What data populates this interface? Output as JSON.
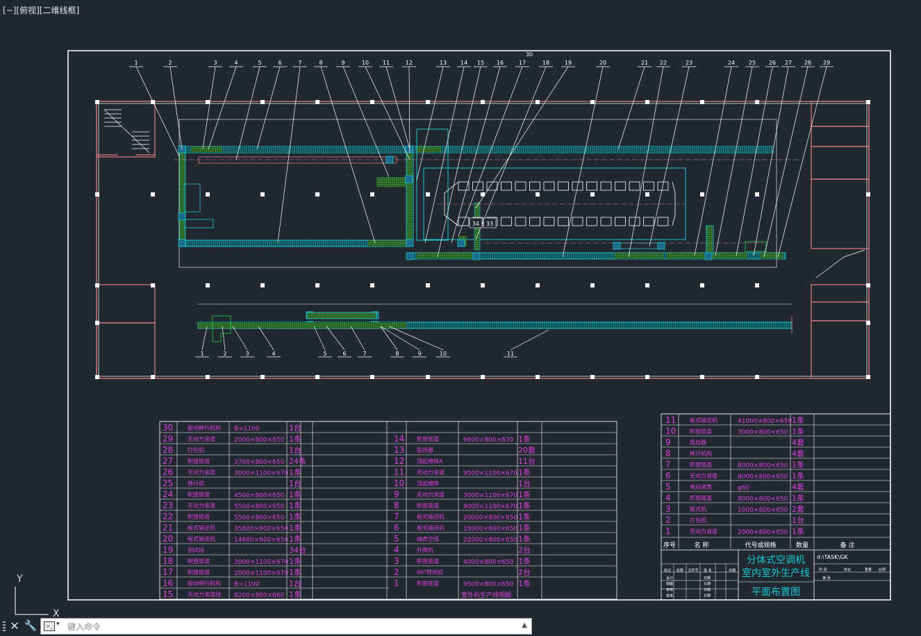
{
  "viewport": {
    "label": "[−][俯视][二维线框]"
  },
  "command": {
    "placeholder": "键入命令",
    "close_icon": "close-icon",
    "tool_icon": "wrench-icon",
    "prompt_icon": "command-prompt-icon",
    "up_icon": "caret-up-icon"
  },
  "ucs": {
    "x_label": "X",
    "y_label": "Y"
  },
  "colors": {
    "background": "#212830",
    "frame": "#ffffff",
    "wall": "#e87f7f",
    "conveyor": "#19c8d2",
    "roller": "#22b14c",
    "parts_text": "#e040e0"
  },
  "balloons_top": [
    "1",
    "2",
    "3",
    "4",
    "5",
    "6",
    "7",
    "8",
    "9",
    "10",
    "11",
    "12",
    "13",
    "14",
    "15",
    "16",
    "17",
    "18",
    "19",
    "20",
    "21",
    "22",
    "23",
    "24",
    "25",
    "26",
    "27",
    "28",
    "29",
    "30"
  ],
  "balloons_bottom": [
    "1",
    "2",
    "3",
    "4",
    "5",
    "6",
    "7",
    "8",
    "9",
    "10",
    "11"
  ],
  "inline_labels": [
    "34",
    "33"
  ],
  "parts_left": [
    {
      "no": "30",
      "name": "振动移行机构",
      "spec": "B=1100",
      "qty": "1台"
    },
    {
      "no": "29",
      "name": "无动力滚道",
      "spec": "2000×800×650",
      "qty": "1条"
    },
    {
      "no": "28",
      "name": "打包机",
      "spec": "",
      "qty": "1台"
    },
    {
      "no": "27",
      "name": "积放链道",
      "spec": "3700×800×650",
      "qty": "24条"
    },
    {
      "no": "26",
      "name": "无动力滚道",
      "spec": "3000×1100×670",
      "qty": "1条"
    },
    {
      "no": "25",
      "name": "移行机",
      "spec": "",
      "qty": "1台"
    },
    {
      "no": "24",
      "name": "积放链道",
      "spec": "4500×800×650",
      "qty": "1条"
    },
    {
      "no": "23",
      "name": "无动力滚道",
      "spec": "5500×800×650",
      "qty": "1条"
    },
    {
      "no": "22",
      "name": "积放链道",
      "spec": "5500×800×650",
      "qty": "1条"
    },
    {
      "no": "21",
      "name": "板式输送机",
      "spec": "35800×800×650",
      "qty": "1条"
    },
    {
      "no": "20",
      "name": "板式输送机",
      "spec": "14600×800×650",
      "qty": "1条"
    },
    {
      "no": "19",
      "name": "测试线",
      "spec": "",
      "qty": "34台"
    },
    {
      "no": "18",
      "name": "积放链道",
      "spec": "3000×1100×670",
      "qty": "1条"
    },
    {
      "no": "17",
      "name": "积放链道",
      "spec": "2000×1100×670",
      "qty": "1条"
    },
    {
      "no": "16",
      "name": "振动移行机构",
      "spec": "B=1100",
      "qty": "1台"
    },
    {
      "no": "15",
      "name": "无动力滚道线",
      "spec": "8200×800×660",
      "qty": "1条"
    }
  ],
  "parts_mid": [
    {
      "no": "14",
      "name": "积放链道",
      "spec": "6600×800×670",
      "qty": "1条"
    },
    {
      "no": "13",
      "name": "阻挡器",
      "spec": "",
      "qty": "20套"
    },
    {
      "no": "12",
      "name": "顶起横移A",
      "spec": "",
      "qty": "11台"
    },
    {
      "no": "11",
      "name": "无动力滚道",
      "spec": "9500×1100×670",
      "qty": "1条"
    },
    {
      "no": "10",
      "name": "顶起横移",
      "spec": "",
      "qty": "1台"
    },
    {
      "no": "9",
      "name": "无动力滚道",
      "spec": "3000×1100×670",
      "qty": "1条"
    },
    {
      "no": "8",
      "name": "积放链道",
      "spec": "4000×1100×670",
      "qty": "1条"
    },
    {
      "no": "7",
      "name": "板式输送机",
      "spec": "20000×800×650",
      "qty": "1条"
    },
    {
      "no": "6",
      "name": "板式输送机",
      "spec": "19000×800×650",
      "qty": "1条"
    },
    {
      "no": "5",
      "name": "抽真空线",
      "spec": "22000×800×650",
      "qty": "1条"
    },
    {
      "no": "4",
      "name": "升降机",
      "spec": "",
      "qty": "2台"
    },
    {
      "no": "3",
      "name": "积放链道",
      "spec": "4000×800×650",
      "qty": "1条"
    },
    {
      "no": "2",
      "name": "90°转向机",
      "spec": "",
      "qty": "2台"
    },
    {
      "no": "1",
      "name": "积放链道",
      "spec": "9500×800×650",
      "qty": "1条"
    }
  ],
  "parts_mid_caption": "室外机生产线明细",
  "parts_right": [
    {
      "no": "11",
      "name": "板式输送机",
      "spec": "41000×800×650",
      "qty": "1条"
    },
    {
      "no": "10",
      "name": "积放链道",
      "spec": "3000×800×650",
      "qty": "1条"
    },
    {
      "no": "9",
      "name": "阻挡器",
      "spec": "",
      "qty": "4套"
    },
    {
      "no": "8",
      "name": "移行机构",
      "spec": "",
      "qty": "4套"
    },
    {
      "no": "7",
      "name": "积放链道",
      "spec": "8000×800×650",
      "qty": "1条"
    },
    {
      "no": "6",
      "name": "无动力滚道",
      "spec": "8000×800×650",
      "qty": "1条"
    },
    {
      "no": "5",
      "name": "电动滚筒",
      "spec": "φ60",
      "qty": "4套"
    },
    {
      "no": "4",
      "name": "积放链道",
      "spec": "8000×800×650",
      "qty": "1条"
    },
    {
      "no": "3",
      "name": "链式机",
      "spec": "1000×800×650",
      "qty": "2套"
    },
    {
      "no": "2",
      "name": "打包机",
      "spec": "",
      "qty": "1台"
    },
    {
      "no": "1",
      "name": "无动力滚道",
      "spec": "2000×800×650",
      "qty": "1条"
    }
  ],
  "parts_right_header": {
    "no": "序号",
    "name": "名 称",
    "spec": "代号或规格",
    "qty": "数量",
    "note": "备 注"
  },
  "title_block": {
    "title_line1": "分体式空调机",
    "title_line2": "室内室外生产线",
    "title_line3": "平面布置图",
    "drawing_no": "d:\\TASK\\GK",
    "label_stage": "阶 段",
    "label_mark": "标记",
    "label_weight": "重量",
    "label_scale": "比例",
    "label_sheet": "第  张",
    "rev_headers": [
      "标记",
      "处数",
      "文件号",
      "签 名",
      "日期"
    ],
    "roles": [
      "设计",
      "制图",
      "审核",
      "批准"
    ],
    "date_label": "日期"
  }
}
